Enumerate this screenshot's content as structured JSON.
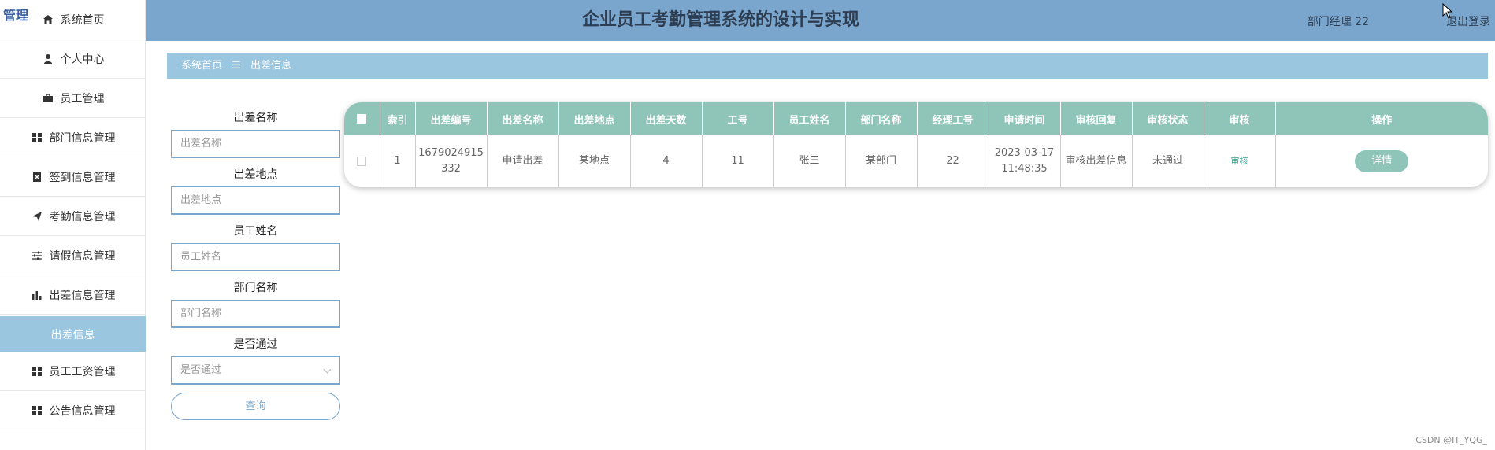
{
  "app": {
    "logo": "管理",
    "title": "企业员工考勤管理系统的设计与实现",
    "user": "部门经理 22",
    "logout": "退出登录"
  },
  "sidebar": {
    "items": [
      {
        "label": "系统首页",
        "icon": "home-icon"
      },
      {
        "label": "个人中心",
        "icon": "user-icon"
      },
      {
        "label": "员工管理",
        "icon": "briefcase-icon"
      },
      {
        "label": "部门信息管理",
        "icon": "grid-icon"
      },
      {
        "label": "签到信息管理",
        "icon": "clipboard-icon"
      },
      {
        "label": "考勤信息管理",
        "icon": "send-icon"
      },
      {
        "label": "请假信息管理",
        "icon": "sliders-icon"
      },
      {
        "label": "出差信息管理",
        "icon": "bar-chart-icon"
      },
      {
        "label": "出差信息",
        "icon": "",
        "active": true
      },
      {
        "label": "员工工资管理",
        "icon": "grid-icon"
      },
      {
        "label": "公告信息管理",
        "icon": "grid-icon"
      }
    ]
  },
  "breadcrumb": {
    "home": "系统首页",
    "separator": "☰",
    "current": "出差信息"
  },
  "filters": {
    "trip_name": {
      "label": "出差名称",
      "placeholder": "出差名称"
    },
    "trip_place": {
      "label": "出差地点",
      "placeholder": "出差地点"
    },
    "employee_name": {
      "label": "员工姓名",
      "placeholder": "员工姓名"
    },
    "department": {
      "label": "部门名称",
      "placeholder": "部门名称"
    },
    "passed": {
      "label": "是否通过",
      "placeholder": "是否通过"
    },
    "query_label": "查询"
  },
  "table": {
    "headers": [
      "索引",
      "出差编号",
      "出差名称",
      "出差地点",
      "出差天数",
      "工号",
      "员工姓名",
      "部门名称",
      "经理工号",
      "申请时间",
      "审核回复",
      "审核状态",
      "审核",
      "操作"
    ],
    "rows": [
      {
        "index": "1",
        "trip_no": "1679024915332",
        "trip_name": "申请出差",
        "trip_place": "某地点",
        "days": "4",
        "emp_no": "11",
        "emp_name": "张三",
        "dept": "某部门",
        "manager_no": "22",
        "apply_time": "2023-03-17 11:48:35",
        "reply": "审核出差信息",
        "status": "未通过",
        "audit": "审核",
        "detail": "详情"
      }
    ]
  },
  "watermark": "CSDN @IT_YQG_",
  "colors": {
    "header": "#7aa6cd",
    "accent": "#9ac6e0",
    "table_header": "#8fc5b9"
  }
}
